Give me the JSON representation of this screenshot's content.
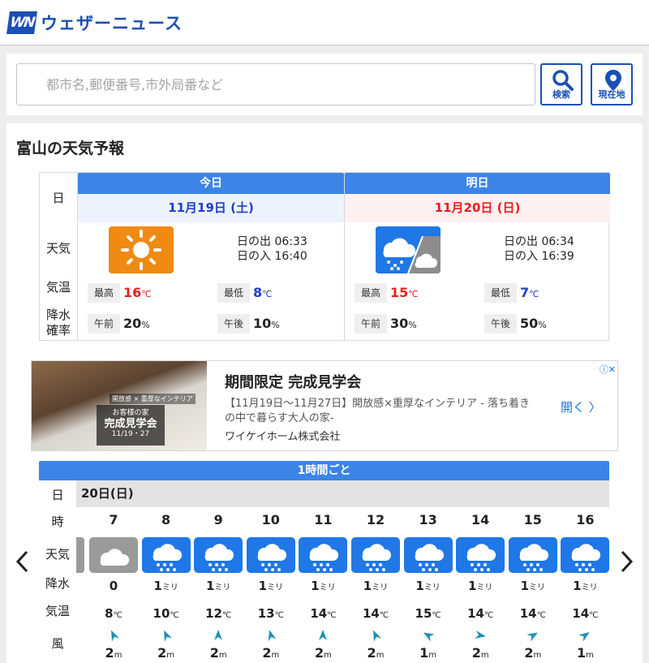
{
  "header": {
    "logo_text": "WN",
    "brand_name": "ウェザーニュース"
  },
  "search": {
    "placeholder": "都市名,郵便番号,市外局番など",
    "search_label": "検索",
    "location_label": "現在地"
  },
  "forecast": {
    "title": "富山の天気予報",
    "row_labels": {
      "day": "日",
      "weather": "天気",
      "temp": "気温",
      "rain_line1": "降水",
      "rain_line2": "確率"
    },
    "days": [
      {
        "head": "今日",
        "date": "11月19日 (土)",
        "icon": "sunny-icon",
        "sunrise": "日の出 06:33",
        "sunset": "日の入 16:40",
        "max_label": "最高",
        "max": "16",
        "min_label": "最低",
        "min": "8",
        "am_label": "午前",
        "am": "20",
        "pm_label": "午後",
        "pm": "10"
      },
      {
        "head": "明日",
        "date": "11月20日 (日)",
        "icon": "rain-then-cloudy-icon",
        "sunrise": "日の出 06:34",
        "sunset": "日の入 16:39",
        "max_label": "最高",
        "max": "15",
        "min_label": "最低",
        "min": "7",
        "am_label": "午前",
        "am": "30",
        "pm_label": "午後",
        "pm": "50"
      }
    ],
    "temp_unit": "℃",
    "pct_unit": "%"
  },
  "ad": {
    "image_tag": "開放感 × 重厚なインテリア",
    "image_plate_line1": "お客様の家",
    "image_plate_line2": "完成見学会",
    "image_plate_line3": "11/19・27",
    "title": "期間限定 完成見学会",
    "description": "【11月19日〜11月27日】開放感×重厚なインテリア - 落ち着きの中で暮らす大人の家-",
    "company": "ワイケイホーム株式会社",
    "open_label": "開く",
    "open_arrow": "〉",
    "info_icon": "ⓘ✕",
    "colors": {
      "link": "#1a73e8"
    }
  },
  "hourly": {
    "head": "1時間ごと",
    "date": "20日(日)",
    "labels": {
      "day": "日",
      "time": "時",
      "weather": "天気",
      "precip": "降水",
      "temp": "気温",
      "wind": "風"
    },
    "precip_unit": "ミリ",
    "temp_unit": "℃",
    "wind_unit": "m",
    "hours": [
      {
        "time": "7",
        "icon": "cloudy-icon",
        "precip": "0",
        "precip_unit": "",
        "temp": "8",
        "wind_dir": "north-northwest",
        "wind_deg": -25,
        "wind": "2"
      },
      {
        "time": "8",
        "icon": "rain-icon",
        "precip": "1",
        "precip_unit": "ミリ",
        "temp": "10",
        "wind_dir": "north-northwest",
        "wind_deg": -25,
        "wind": "2"
      },
      {
        "time": "9",
        "icon": "rain-icon",
        "precip": "1",
        "precip_unit": "ミリ",
        "temp": "12",
        "wind_dir": "north",
        "wind_deg": 0,
        "wind": "2"
      },
      {
        "time": "10",
        "icon": "rain-icon",
        "precip": "1",
        "precip_unit": "ミリ",
        "temp": "13",
        "wind_dir": "north-northwest",
        "wind_deg": -15,
        "wind": "2"
      },
      {
        "time": "11",
        "icon": "rain-icon",
        "precip": "1",
        "precip_unit": "ミリ",
        "temp": "14",
        "wind_dir": "north",
        "wind_deg": 0,
        "wind": "2"
      },
      {
        "time": "12",
        "icon": "rain-icon",
        "precip": "1",
        "precip_unit": "ミリ",
        "temp": "14",
        "wind_dir": "north-northwest",
        "wind_deg": -25,
        "wind": "2"
      },
      {
        "time": "13",
        "icon": "rain-icon",
        "precip": "1",
        "precip_unit": "ミリ",
        "temp": "15",
        "wind_dir": "west-northwest",
        "wind_deg": -60,
        "wind": "1"
      },
      {
        "time": "14",
        "icon": "rain-icon",
        "precip": "1",
        "precip_unit": "ミリ",
        "temp": "14",
        "wind_dir": "east",
        "wind_deg": 100,
        "wind": "2"
      },
      {
        "time": "15",
        "icon": "rain-icon",
        "precip": "1",
        "precip_unit": "ミリ",
        "temp": "14",
        "wind_dir": "east-northeast",
        "wind_deg": 60,
        "wind": "2"
      },
      {
        "time": "16",
        "icon": "rain-icon",
        "precip": "1",
        "precip_unit": "ミリ",
        "temp": "14",
        "wind_dir": "east-northeast",
        "wind_deg": 55,
        "wind": "1"
      }
    ]
  },
  "colors": {
    "brand": "#1b4fb4",
    "header_blue": "#3c84e6",
    "sun_orange": "#f08a12",
    "rain_blue": "#1f78e6",
    "cloud_gray": "#9a9a9a",
    "max_red": "#e52020",
    "min_blue": "#1f3ecc"
  }
}
